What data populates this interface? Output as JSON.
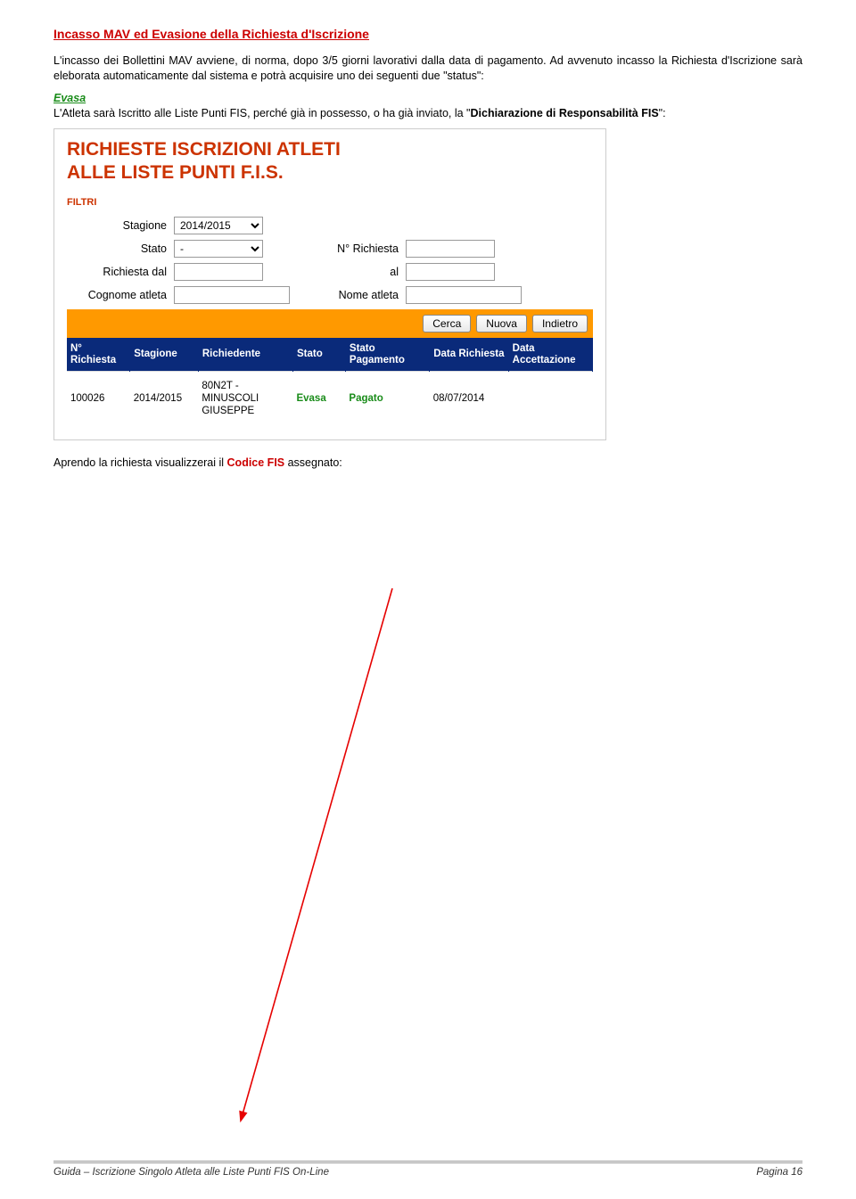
{
  "sectionTitle": "Incasso MAV ed Evasione della Richiesta d'Iscrizione",
  "para1": "L'incasso dei Bollettini MAV avviene, di norma, dopo 3/5 giorni lavorativi dalla data di pagamento. Ad avvenuto incasso la Richiesta d'Iscrizione sarà eleborata automaticamente dal sistema e potrà acquisire uno dei seguenti due \"status\":",
  "evasaLabel": "Evasa",
  "para2a": "L'Atleta sarà Iscritto alle Liste Punti FIS, perché già in possesso, o ha già inviato, la \"",
  "para2b": "Dichiarazione di Responsabilità FIS",
  "para2c": "\":",
  "ss": {
    "title1": "RICHIESTE ISCRIZIONI ATLETI",
    "title2": "ALLE LISTE PUNTI F.I.S.",
    "filtri": "FILTRI",
    "labels": {
      "stagione": "Stagione",
      "stato": "Stato",
      "nRichiesta": "N° Richiesta",
      "richiestaDal": "Richiesta dal",
      "al": "al",
      "cognome": "Cognome atleta",
      "nome": "Nome atleta"
    },
    "stagioneVal": "2014/2015",
    "statoVal": "-",
    "btnCerca": "Cerca",
    "btnNuova": "Nuova",
    "btnIndietro": "Indietro",
    "headers": {
      "nRich": "N° Richiesta",
      "stag": "Stagione",
      "rich": "Richiedente",
      "stato": "Stato",
      "statoPag": "Stato Pagamento",
      "dataRich": "Data Richiesta",
      "dataAcc": "Data Accettazione"
    },
    "row": {
      "n": "100026",
      "stag": "2014/2015",
      "rich": "80N2T - MINUSCOLI GIUSEPPE",
      "stato": "Evasa",
      "pag": "Pagato",
      "dataR": "08/07/2014",
      "dataA": ""
    }
  },
  "afterA": "Aprendo la richiesta visualizzerai il ",
  "afterB": "Codice FIS",
  "afterC": " assegnato:",
  "footerLeft": "Guida – Iscrizione Singolo Atleta alle Liste Punti FIS On-Line",
  "footerRight": "Pagina 16"
}
